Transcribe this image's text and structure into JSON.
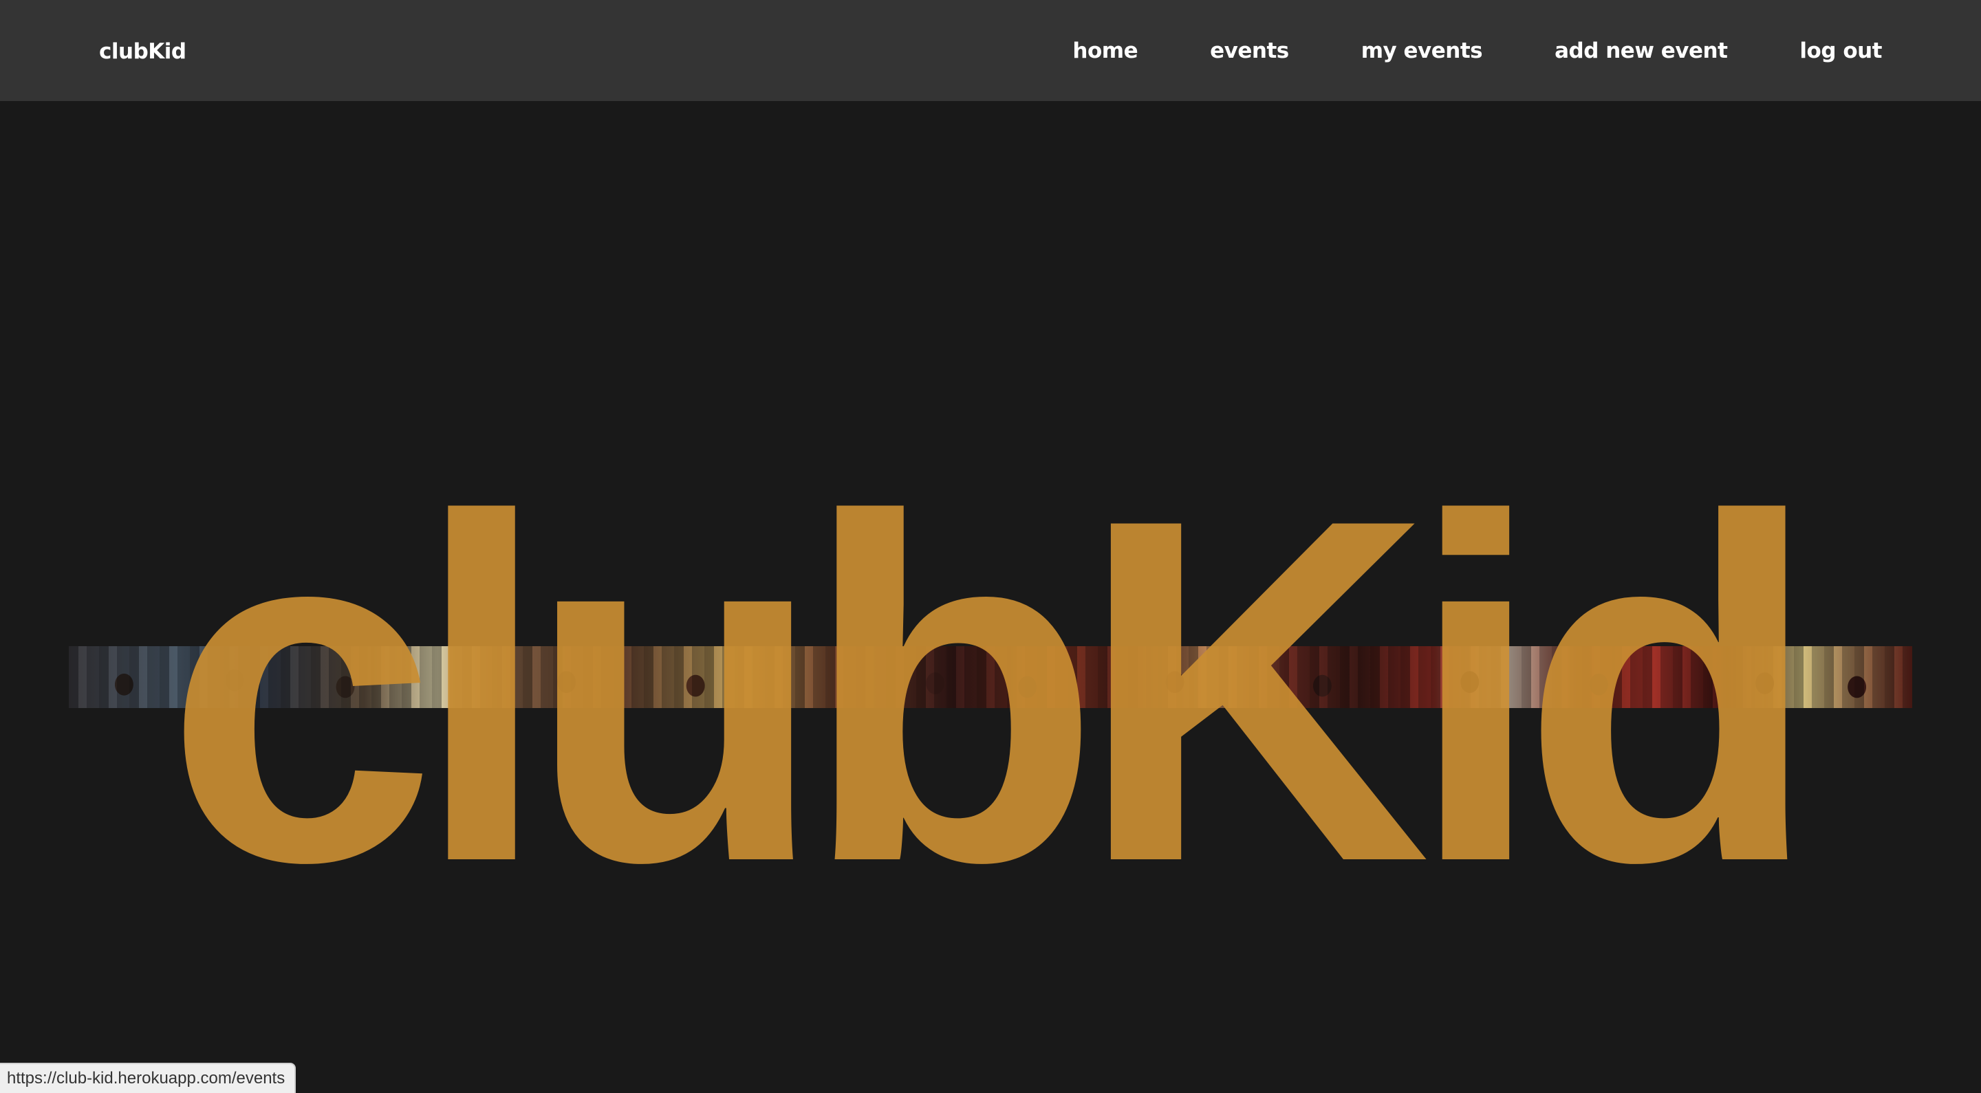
{
  "navbar": {
    "brand": "clubKid",
    "links": [
      {
        "label": "home"
      },
      {
        "label": "events"
      },
      {
        "label": "my events"
      },
      {
        "label": "add new event"
      },
      {
        "label": "log out"
      }
    ]
  },
  "hero": {
    "title": "clubKid",
    "image": "crowd-photo"
  },
  "status_bar": {
    "url": "https://club-kid.herokuapp.com/events"
  },
  "colors": {
    "navbar_bg": "#343434",
    "page_bg": "#191919",
    "accent": "#C98D32",
    "nav_text": "#FFFFFF"
  }
}
